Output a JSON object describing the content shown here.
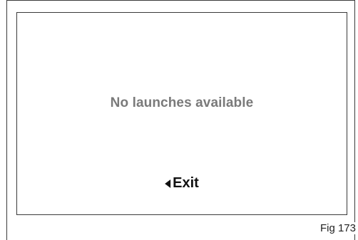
{
  "screen": {
    "message": "No launches available",
    "exit_label": "Exit"
  },
  "icons": {
    "exit_arrow": "left-triangle-icon"
  },
  "caption": "Fig 173",
  "colors": {
    "message_text": "#7a7a7a",
    "exit_text": "#111111",
    "border": "#3a3a3a"
  }
}
